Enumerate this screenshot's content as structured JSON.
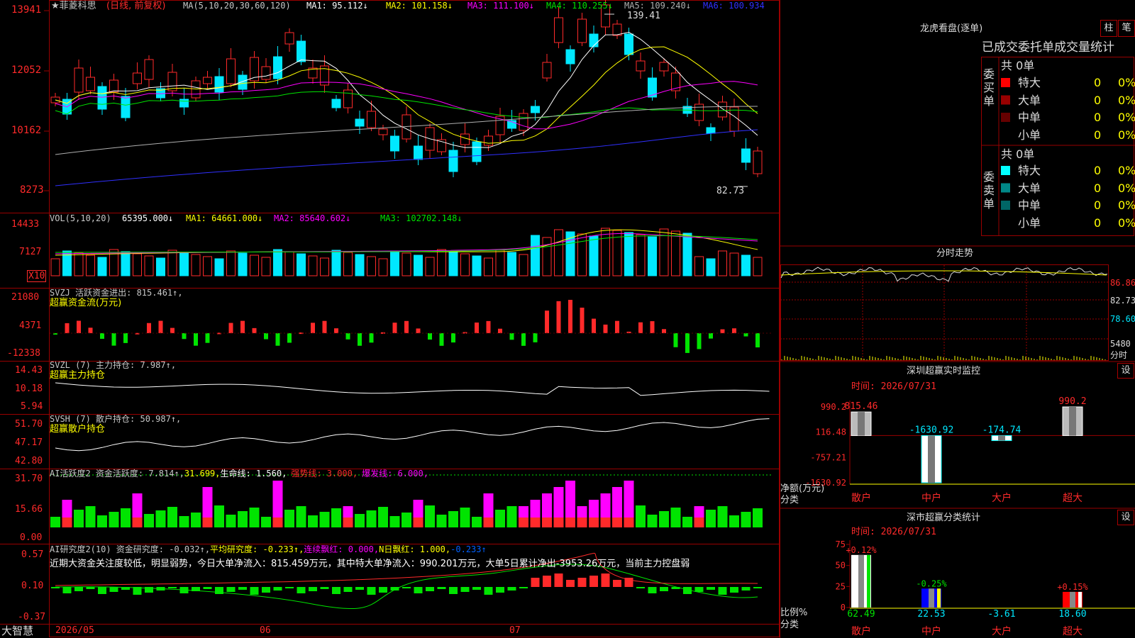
{
  "colors": {
    "up": "#ff2a2a",
    "down": "#00e8ff",
    "green": "#00e400",
    "magenta": "#ff00ff",
    "bg": "#000000",
    "grid": "#990000",
    "white": "#ffffff",
    "yellow": "#ffff00",
    "gray": "#b0b0b0",
    "blue": "#3030ff"
  },
  "main": {
    "title": "★菲菱科思",
    "mode": "(日线, 前复权)",
    "ma_head": "MA(5,10,20,30,60,120)",
    "ma": [
      {
        "label": "MA1: 95.112↓",
        "color": "#ffffff"
      },
      {
        "label": "MA2: 101.158↓",
        "color": "#ffff00"
      },
      {
        "label": "MA3: 111.100↓",
        "color": "#ff00ff"
      },
      {
        "label": "MA4: 110.255↓",
        "color": "#00e400"
      },
      {
        "label": "MA5: 109.240↓",
        "color": "#b0b0b0"
      },
      {
        "label": "MA6: 100.934",
        "color": "#3030ff"
      }
    ],
    "y_ticks": [
      "13941",
      "12052",
      "10162",
      "8273"
    ],
    "high_label": "139.41",
    "low_label": "82.73"
  },
  "vol": {
    "head": "VOL(5,10,20)",
    "value": "65395.000↓",
    "ma": [
      {
        "label": "MA1: 64661.000↓",
        "color": "#ffff00"
      },
      {
        "label": "MA2: 85640.602↓",
        "color": "#ff00ff"
      },
      {
        "label": "MA3: 102702.148↓",
        "color": "#00e400"
      }
    ],
    "y_ticks": [
      "14433",
      "7127"
    ],
    "unit": "X10"
  },
  "svzj": {
    "head": "SVZJ  活跃资金进出: 815.461↑,",
    "sub": "超赢资金流(万元)",
    "y_ticks": [
      "21080",
      "4371",
      "-12338"
    ]
  },
  "svzl": {
    "head": "SVZL (7) 主力持仓: 7.987↑,",
    "sub": "超赢主力持仓",
    "y_ticks": [
      "14.43",
      "10.18",
      "5.94"
    ]
  },
  "svsh": {
    "head": "SVSH (7) 散户持仓: 50.987↑,",
    "sub": "超赢散户持仓",
    "y_ticks": [
      "51.70",
      "47.17",
      "42.80"
    ]
  },
  "ai1": {
    "head": "AI活跃度2 资金活跃度: 7.814↑,",
    "v2": "31.699,",
    "v3": "生命线: 1.560,",
    "v4": "强势线: 3.000,",
    "v5": "爆发线: 6.000,",
    "y_ticks": [
      "31.70",
      "15.66",
      "0.00"
    ]
  },
  "ai2": {
    "head": "AI研究度2(10) 资金研究度: -0.032↑,",
    "v2": "平均研究度: -0.233↑,",
    "v3": "连续飘红: 0.000,",
    "v4": "N日飘红: 1.000,",
    "v5": "-0.233↑",
    "note": "近期大资金关注度较低，明显弱势，今日大单净流入：815.459万元，其中特大单净流入：990.201万元，大单5日累计净出-3953.26万元，当前主力控盘弱",
    "y_ticks": [
      "0.57",
      "0.10",
      "-0.37"
    ]
  },
  "bottom": {
    "logo": "大智慧",
    "dates": [
      "2026/05",
      "06",
      "07"
    ]
  },
  "longhu": {
    "title": "龙虎看盘(逐单)",
    "btn_zhu": "柱",
    "btn_bi": "笔",
    "tabs": "已成交委托单成交量统计",
    "buy_label": "委买单",
    "sell_label": "委卖单",
    "buy_total": "共 0单",
    "sell_total": "共 0单",
    "buy_rows": [
      {
        "name": "特大",
        "n": "0",
        "p": "0%",
        "color": "#ff0000"
      },
      {
        "name": "大单",
        "n": "0",
        "p": "0%",
        "color": "#990000"
      },
      {
        "name": "中单",
        "n": "0",
        "p": "0%",
        "color": "#660000"
      },
      {
        "name": "小单",
        "n": "0",
        "p": "0%",
        "color": ""
      }
    ],
    "sell_rows": [
      {
        "name": "特大",
        "n": "0",
        "p": "0%",
        "color": "#00ffff"
      },
      {
        "name": "大单",
        "n": "0",
        "p": "0%",
        "color": "#008888"
      },
      {
        "name": "中单",
        "n": "0",
        "p": "0%",
        "color": "#006666"
      },
      {
        "name": "小单",
        "n": "0",
        "p": "0%",
        "color": ""
      }
    ]
  },
  "fenshi": {
    "title": "分时走势",
    "y_ticks": [
      "86.86",
      "82.73",
      "78.60",
      "5480",
      "分时"
    ]
  },
  "monitor": {
    "title": "深圳超赢实时监控",
    "set": "设",
    "time": "时间: 2026/07/31",
    "y_ticks": [
      "990.2",
      "116.48",
      "-757.21",
      "-1630.92"
    ],
    "axis_label": "净额(万元)",
    "axis_label2": "分类",
    "bars": [
      {
        "cat": "散户",
        "value": 815.46,
        "label": "815.46"
      },
      {
        "cat": "中户",
        "value": -1630.92,
        "label": "-1630.92"
      },
      {
        "cat": "大户",
        "value": -174.74,
        "label": "-174.74"
      },
      {
        "cat": "超大",
        "value": 990.2,
        "label": "990.2"
      }
    ]
  },
  "stats": {
    "title": "深市超赢分类统计",
    "set": "设",
    "time": "时间: 2026/07/31",
    "y_ticks": [
      "75",
      "50",
      "25",
      "0"
    ],
    "axis_label": "比例%",
    "axis_label2": "分类",
    "bars": [
      {
        "cat": "散户",
        "value": 62.49,
        "label": "62.49",
        "change": "+0.12%"
      },
      {
        "cat": "中户",
        "value": 22.53,
        "label": "22.53",
        "change": "-0.25%"
      },
      {
        "cat": "大户",
        "value": -3.61,
        "label": "-3.61",
        "change": ""
      },
      {
        "cat": "超大",
        "value": 18.6,
        "label": "18.60",
        "change": "+0.15%"
      }
    ]
  }
}
